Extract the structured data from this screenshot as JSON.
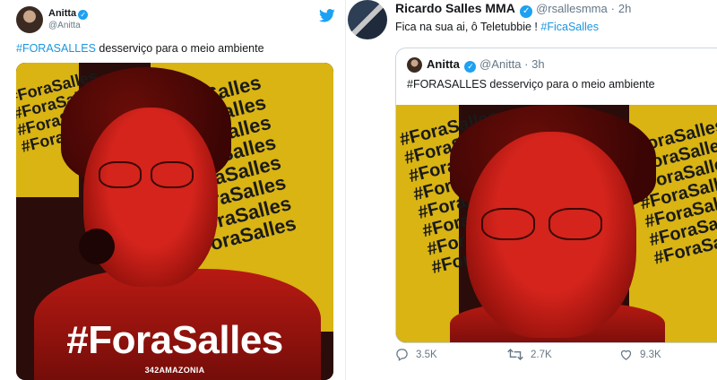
{
  "left_tweet": {
    "name": "Anitta",
    "handle": "@Anitta",
    "text_hashtag": "#FORASALLES",
    "text_rest": " desserviço para o meio ambiente",
    "image": {
      "title": "#ForaSalles",
      "brand": "342AMAZONIA",
      "pattern_word": "#ForaSalles"
    }
  },
  "right_tweet": {
    "name": "Ricardo Salles MMA",
    "handle": "@rsallesmma",
    "separator": "·",
    "time": "2h",
    "text_plain": "Fica na sua ai, ô Teletubbie ! ",
    "text_hashtag": "#FicaSalles",
    "quoted": {
      "name": "Anitta",
      "handle": "@Anitta",
      "separator": "·",
      "time": "3h",
      "text": "#FORASALLES desserviço para o meio ambiente"
    },
    "actions": {
      "reply_count": "3.5K",
      "retweet_count": "2.7K",
      "like_count": "9.3K"
    }
  },
  "colors": {
    "link_blue": "#1b95e0",
    "verified_blue": "#1da1f2",
    "muted_gray": "#657786",
    "art_yellow": "#d9b413",
    "art_red": "#d4241c"
  },
  "icons": {
    "verified": "verified-badge-icon",
    "twitter": "twitter-bird-icon",
    "reply": "reply-icon",
    "retweet": "retweet-icon",
    "like": "heart-icon"
  }
}
